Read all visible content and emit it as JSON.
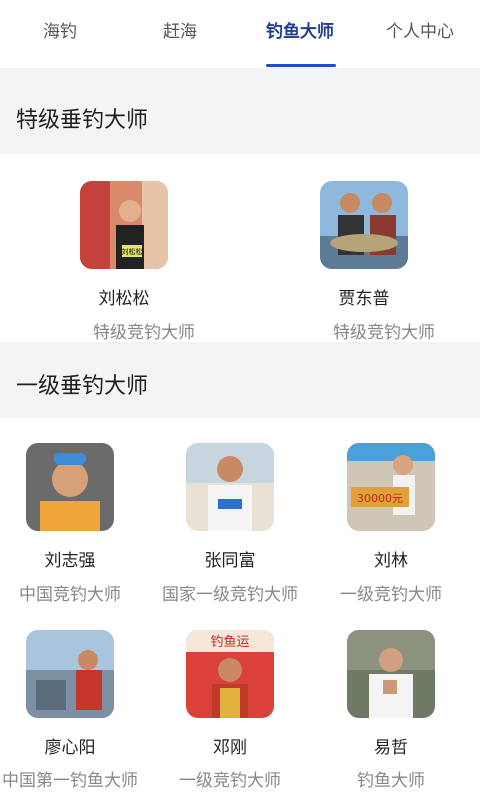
{
  "tabs": [
    {
      "label": "海钓"
    },
    {
      "label": "赶海"
    },
    {
      "label": "钓鱼大师"
    },
    {
      "label": "个人中心"
    }
  ],
  "sections": [
    {
      "title": "特级垂钓大师",
      "masters": [
        {
          "name": "刘松松",
          "rank": "特级竞钓大师"
        },
        {
          "name": "贾东普",
          "rank": "特级竞钓大师"
        }
      ]
    },
    {
      "title": "一级垂钓大师",
      "masters": [
        {
          "name": "刘志强",
          "rank": "中国竞钓大师"
        },
        {
          "name": "张同富",
          "rank": "国家一级竞钓大师"
        },
        {
          "name": "刘林",
          "rank": "一级竞钓大师"
        },
        {
          "name": "廖心阳",
          "rank": "中国第一钓鱼大师"
        },
        {
          "name": "邓刚",
          "rank": "一级竞钓大师"
        },
        {
          "name": "易哲",
          "rank": "钓鱼大师"
        }
      ]
    }
  ],
  "colors": {
    "accent": "#1f4fc8",
    "section_bg": "#f3f4f6",
    "rank_text": "#888888"
  },
  "photo_text": {
    "sign": "刘松松",
    "banner": "30000元",
    "banner2": "钓鱼运"
  }
}
